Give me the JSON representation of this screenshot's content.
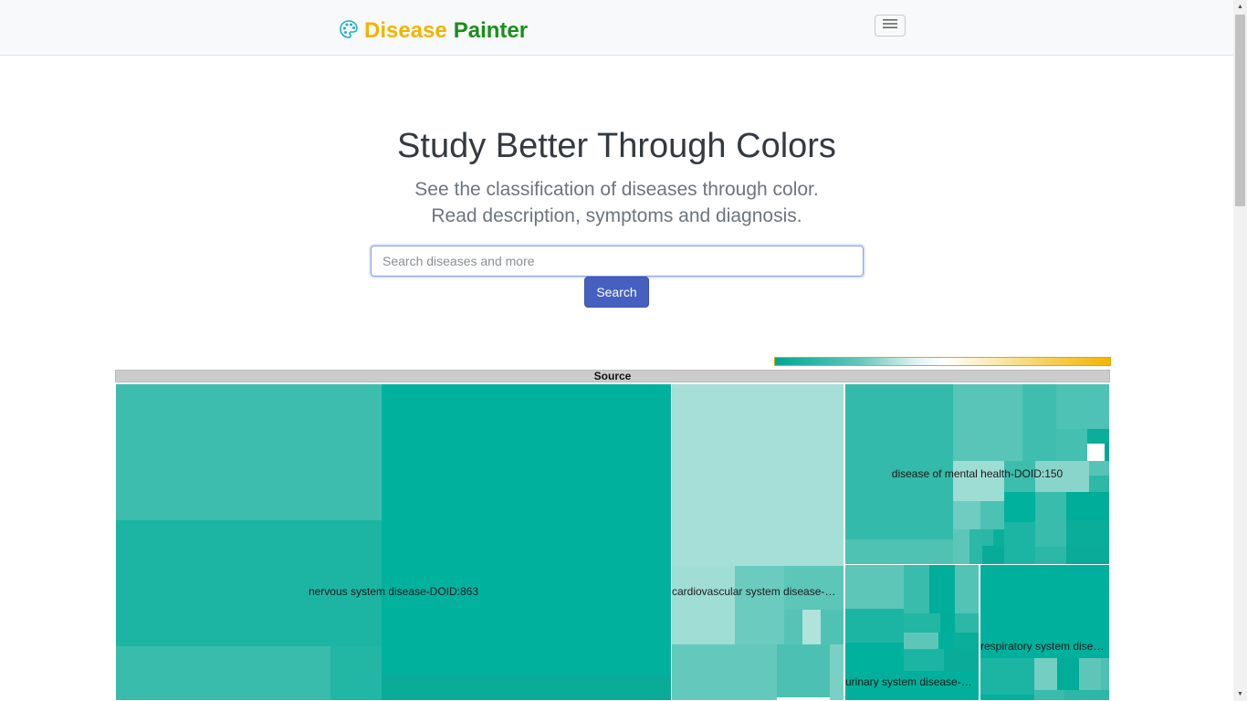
{
  "navbar": {
    "brand_word1": "Disease",
    "brand_word2": "Painter",
    "brand_icon": "palette-icon",
    "menu_icon": "hamburger-menu-icon",
    "brand_colors": {
      "word1": "#f0b400",
      "word2": "#1a8f1a",
      "icon": "#1ab0c8"
    }
  },
  "hero": {
    "title": "Study Better Through Colors",
    "subtitle_line1": "See the classification of diseases through color.",
    "subtitle_line2": "Read description, symptoms and diagnosis."
  },
  "search": {
    "placeholder": "Search diseases and more",
    "value": "",
    "button_label": "Search"
  },
  "treemap": {
    "root_label": "Source",
    "color_scale": {
      "low": "#00a693",
      "mid": "#ffffff",
      "high": "#f2b600"
    },
    "categories": [
      {
        "name": "nervous system disease-DOID:863"
      },
      {
        "name": "cardiovascular system disease-D…"
      },
      {
        "name": "disease of mental health-DOID:150"
      },
      {
        "name": "urinary system disease-D…"
      },
      {
        "name": "respiratory system disea…"
      }
    ]
  }
}
